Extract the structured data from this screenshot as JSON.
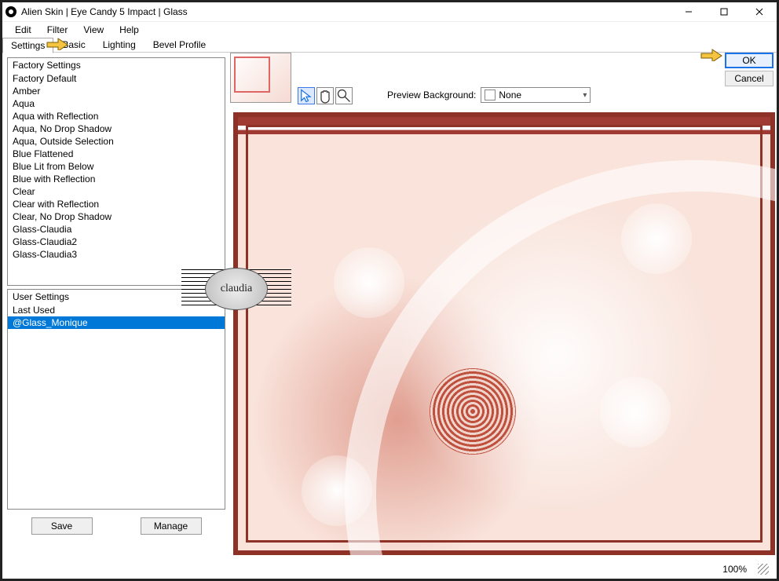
{
  "window": {
    "title": "Alien Skin | Eye Candy 5 Impact | Glass"
  },
  "menubar": {
    "items": [
      "Edit",
      "Filter",
      "View",
      "Help"
    ]
  },
  "tabs": {
    "items": [
      "Settings",
      "Basic",
      "Lighting",
      "Bevel Profile"
    ],
    "selected": "Settings"
  },
  "factory_settings": {
    "header": "Factory Settings",
    "items": [
      "Factory Default",
      "Amber",
      "Aqua",
      "Aqua with Reflection",
      "Aqua, No Drop Shadow",
      "Aqua, Outside Selection",
      "Blue Flattened",
      "Blue Lit from Below",
      "Blue with Reflection",
      "Clear",
      "Clear with Reflection",
      "Clear, No Drop Shadow",
      "Glass-Claudia",
      "Glass-Claudia2",
      "Glass-Claudia3"
    ]
  },
  "user_settings": {
    "header": "User Settings",
    "items": [
      "Last Used",
      "@Glass_Monique"
    ],
    "selected": "@Glass_Monique"
  },
  "buttons": {
    "save": "Save",
    "manage": "Manage",
    "ok": "OK",
    "cancel": "Cancel"
  },
  "preview_bg": {
    "label": "Preview Background:",
    "value": "None"
  },
  "status": {
    "zoom": "100%"
  },
  "watermark": {
    "text": "claudia"
  }
}
